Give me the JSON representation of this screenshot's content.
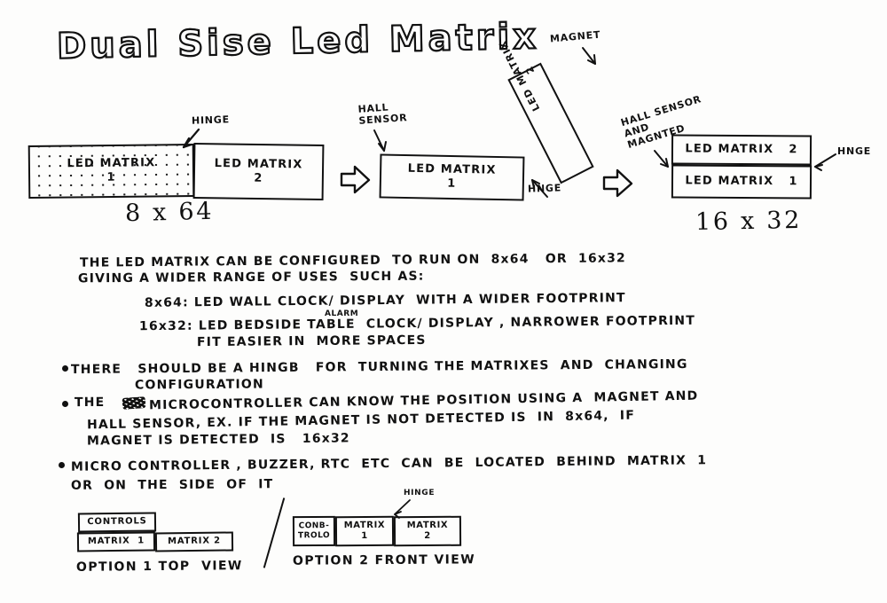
{
  "title": "Dual Sise Led Matrix",
  "diagram_1": {
    "caption": "8 x 64",
    "hinge_label": "HINGE",
    "panel_1": "LED MATRIX\n1",
    "panel_2": "LED MATRIX\n2"
  },
  "diagram_2": {
    "hall_sensor_label": "HALL\nSENSOR",
    "magnet_label": "MAGNET",
    "hinge_label": "HNGE",
    "panel_1": "LED MATRIX\n1",
    "panel_2": "LED MATRIX\n2"
  },
  "diagram_3": {
    "caption": "16 x 32",
    "hall_magnet_label": "HALL SENSOR\nAND\nMAGNTED",
    "hinge_label": "HNGE",
    "panel_top": "LED MATRIX   2",
    "panel_bottom": "LED MATRIX   1"
  },
  "body": {
    "intro_line_1": "THE LED MATRIX CAN BE CONFIGURED  TO RUN ON  8x64   OR  16x32",
    "intro_line_2": "GIVING A WIDER RANGE OF USES  SUCH AS:",
    "use_1": "8x64: LED WALL CLOCK/ DISPLAY  WITH A WIDER FOOTPRINT",
    "use_2": "16x32: LED BEDSIDE TABLE  CLOCK/ DISPLAY , NARROWER FOOTPRINT",
    "use_2_superscript": "ALARM",
    "use_2_cont": "FIT EASIER IN  MORE SPACES",
    "bullet_1_line_1": "THERE   SHOULD BE A HINGB   FOR  TURNING THE MATRIXES  AND  CHANGING",
    "bullet_1_line_2": "CONFIGURATION",
    "bullet_2_line_1_pre": "THE",
    "bullet_2_line_1_post": "MICROCONTROLLER CAN KNOW THE POSITION USING A  MAGNET AND",
    "bullet_2_line_2": "HALL SENSOR, EX. IF THE MAGNET IS NOT DETECTED IS  IN  8x64,  IF",
    "bullet_2_line_3": "MAGNET IS DETECTED  IS   16x32",
    "bullet_3_line_1": "MICRO CONTROLLER , BUZZER, RTC  ETC  CAN  BE  LOCATED  BEHIND  MATRIX  1",
    "bullet_3_line_2": "OR  ON  THE  SIDE  OF  IT"
  },
  "option_1": {
    "controls": "CONTROLS",
    "matrix_1": "MATRIX  1",
    "matrix_2": "MATRIX 2",
    "caption": "OPTION 1 TOP  VIEW"
  },
  "option_2": {
    "controls": "CONB-\nTROLO",
    "matrix_1": "MATRIX\n1",
    "matrix_2": "MATRIX\n2",
    "hinge_label": "HINGE",
    "caption": "OPTION 2 FRONT VIEW"
  }
}
